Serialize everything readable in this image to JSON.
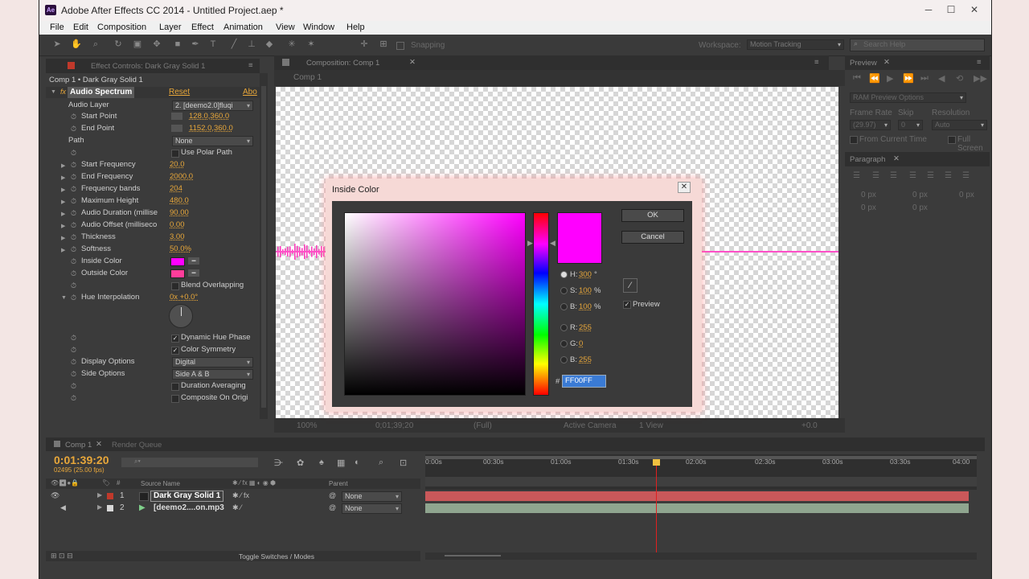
{
  "titlebar": {
    "title": "Adobe After Effects CC 2014 - Untitled Project.aep *",
    "app_icon": "Ae"
  },
  "menu": [
    "File",
    "Edit",
    "Composition",
    "Layer",
    "Effect",
    "Animation",
    "View",
    "Window",
    "Help"
  ],
  "toolbar": {
    "snapping": "Snapping",
    "workspace_label": "Workspace:",
    "workspace_value": "Motion Tracking",
    "search_placeholder": "Search Help"
  },
  "effect_controls": {
    "tab": "Effect Controls: Dark Gray Solid 1",
    "crumb": "Comp 1 • Dark Gray Solid 1",
    "effect": "Audio Spectrum",
    "reset": "Reset",
    "about": "Abo",
    "audio_layer_label": "Audio Layer",
    "audio_layer_value": "2. [deemo2.0]fluqi",
    "start_point": {
      "label": "Start Point",
      "value": "128.0,360.0"
    },
    "end_point": {
      "label": "End Point",
      "value": "1152.0,360.0"
    },
    "path_label": "Path",
    "path_value": "None",
    "polar": "Use Polar Path",
    "props": [
      {
        "label": "Start Frequency",
        "value": "20.0"
      },
      {
        "label": "End Frequency",
        "value": "2000.0"
      },
      {
        "label": "Frequency bands",
        "value": "204"
      },
      {
        "label": "Maximum Height",
        "value": "480.0"
      },
      {
        "label": "Audio Duration (millise",
        "value": "90.00"
      },
      {
        "label": "Audio Offset (milliseco",
        "value": "0.00"
      },
      {
        "label": "Thickness",
        "value": "3.00"
      },
      {
        "label": "Softness",
        "value": "50.0%"
      }
    ],
    "inside_color": {
      "label": "Inside Color",
      "color": "#ff00ff"
    },
    "outside_color": {
      "label": "Outside Color",
      "color": "#ff3d9a"
    },
    "blend": "Blend Overlapping",
    "hue_interp": {
      "label": "Hue Interpolation",
      "value": "0x +0.0°"
    },
    "dynamic_hue": "Dynamic Hue Phase",
    "color_symmetry": "Color Symmetry",
    "display_options": {
      "label": "Display Options",
      "value": "Digital"
    },
    "side_options": {
      "label": "Side Options",
      "value": "Side A & B"
    },
    "duration_avg": "Duration Averaging",
    "composite": "Composite On Origi"
  },
  "composition": {
    "tab": "Composition: Comp 1",
    "sub_tab": "Comp 1",
    "zoom": "100%",
    "timecode": "0;01;39;20",
    "res": "(Full)",
    "camera": "Active Camera",
    "views": "1 View",
    "exposure": "+0.0"
  },
  "preview": {
    "tab": "Preview",
    "ram": "RAM Preview Options",
    "frame_rate_label": "Frame Rate",
    "skip_label": "Skip",
    "resolution_label": "Resolution",
    "frame_rate": "(29.97)",
    "skip": "0",
    "resolution": "Auto",
    "from_current": "From Current Time",
    "full_screen": "Full Screen"
  },
  "paragraph": {
    "tab": "Paragraph",
    "v1": "0 px",
    "v2": "0 px",
    "v3": "0 px",
    "v4": "0 px",
    "v5": "0 px"
  },
  "dialog": {
    "title": "Inside Color",
    "ok": "OK",
    "cancel": "Cancel",
    "preview": "Preview",
    "h_label": "H:",
    "h": "300",
    "h_unit": "°",
    "s_label": "S:",
    "s": "100",
    "s_unit": "%",
    "b_label": "B:",
    "b": "100",
    "b_unit": "%",
    "r_label": "R:",
    "r": "255",
    "g_label": "G:",
    "g": "0",
    "bb_label": "B:",
    "bb": "255",
    "hash": "#",
    "hex": "FF00FF",
    "swatch": "#ff00ff"
  },
  "timeline": {
    "tab": "Comp 1",
    "render_tab": "Render Queue",
    "timecode": "0:01:39:20",
    "frames": "02495 (25.00 fps)",
    "col_source": "Source Name",
    "col_parent": "Parent",
    "ticks": [
      "0:00s",
      "00:30s",
      "01:00s",
      "01:30s",
      "02:00s",
      "02:30s",
      "03:00s",
      "03:30s",
      "04:00"
    ],
    "layers": [
      {
        "num": "1",
        "name": "Dark Gray Solid 1",
        "parent": "None",
        "color": "#c0392b"
      },
      {
        "num": "2",
        "name": "[deemo2....on.mp3",
        "parent": "None",
        "color": "#d8d8d8"
      }
    ],
    "toggle": "Toggle Switches / Modes",
    "playhead_fraction": 0.418
  }
}
